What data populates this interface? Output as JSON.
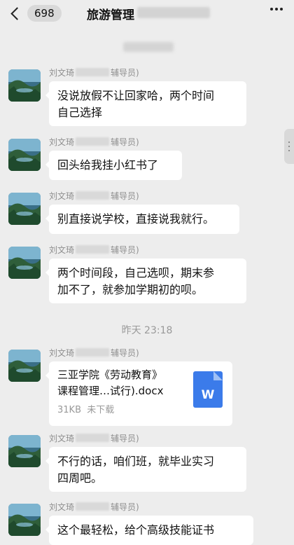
{
  "header": {
    "back_count": "698",
    "title": "旅游管理"
  },
  "timestamps": {
    "divider_1": "",
    "divider_2": "昨天 23:18"
  },
  "sender": {
    "name_prefix": "刘文琦",
    "name_suffix": "辅导员)"
  },
  "messages": [
    {
      "type": "text",
      "text": "没说放假不让回家哈，两个时间\n自己选择"
    },
    {
      "type": "text",
      "text": "回头给我挂小红书了"
    },
    {
      "type": "text",
      "text": "别直接说学校，直接说我就行。"
    },
    {
      "type": "text",
      "text": "两个时间段，自己选呗，期末参\n加不了，就参加学期初的呗。"
    },
    {
      "type": "file",
      "file_name": "三亚学院《劳动教育》\n课程管理…试行).docx",
      "size": "31KB",
      "status": "未下载",
      "icon_letter": "W"
    },
    {
      "type": "text",
      "text": "不行的话，咱们班，就毕业实习\n四周吧。"
    },
    {
      "type": "text",
      "text": "这个最轻松，给个高级技能证书"
    }
  ],
  "colors": {
    "background": "#ededed",
    "bubble": "#ffffff",
    "word_icon": "#3b7bea"
  }
}
